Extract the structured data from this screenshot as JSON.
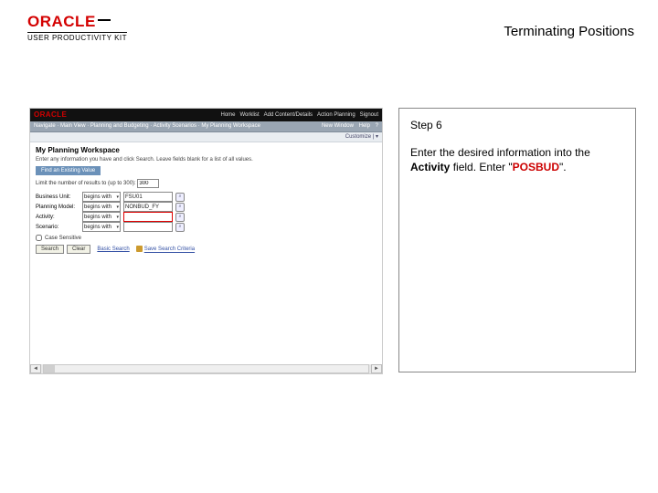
{
  "header": {
    "brand": "ORACLE",
    "upk": "USER PRODUCTIVITY KIT",
    "doc_title": "Terminating Positions"
  },
  "app": {
    "topbar": {
      "brand": "ORACLE",
      "menus": [
        "Home",
        "Worklist",
        "Add Content/Details",
        "Action Planning",
        "Signout"
      ]
    },
    "crumb_left": "Navigate · Main View · Planning and Budgeting · Activity Scenarios · My Planning Workspace",
    "crumb_right": [
      "New Window",
      "Help",
      "?"
    ],
    "toolbar2_text": "Customize | ▾",
    "ws_title": "My Planning Workspace",
    "desc": "Enter any information you have and click Search. Leave fields blank for a list of all values.",
    "tabs": [
      "Find an Existing Value"
    ],
    "limit_label": "Limit the number of results to (up to 300):",
    "limit_value": "300",
    "rows": [
      {
        "label": "Business Unit:",
        "op": "begins with",
        "val": "FSU01"
      },
      {
        "label": "Planning Model:",
        "op": "begins with",
        "val": "NONBUD_FY"
      },
      {
        "label": "Activity:",
        "op": "begins with",
        "val": "",
        "highlight": true
      },
      {
        "label": "Scenario:",
        "op": "begins with",
        "val": ""
      }
    ],
    "case_label": "Case Sensitive",
    "buttons": {
      "search": "Search",
      "clear": "Clear",
      "basic": "Basic Search",
      "save": "Save Search Criteria"
    }
  },
  "instruction": {
    "step_label": "Step 6",
    "line1": "Enter the desired information into the ",
    "bold": "Activity",
    "line2": " field. Enter \"",
    "code": "POSBUD",
    "line3": "\"."
  }
}
